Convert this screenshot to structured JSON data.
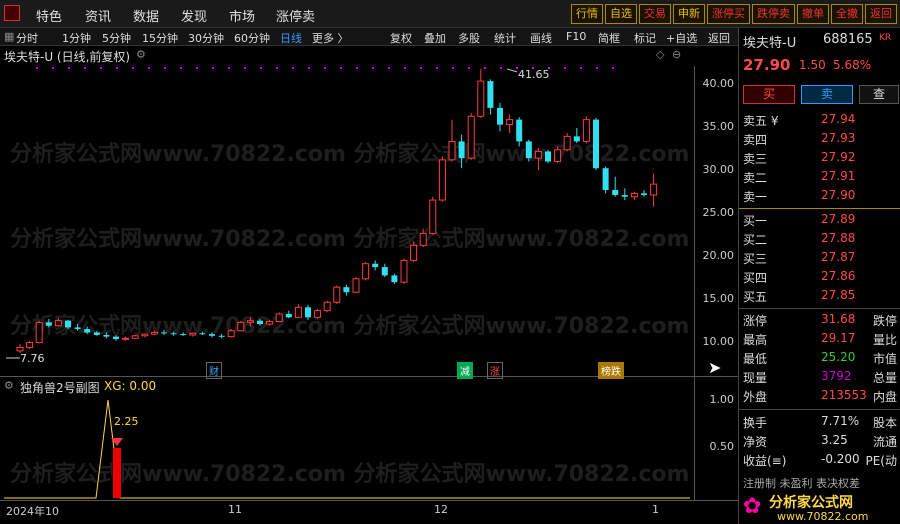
{
  "menu": {
    "items": [
      "特色",
      "资讯",
      "数据",
      "发现",
      "市场",
      "涨停卖"
    ]
  },
  "top_buttons": [
    "行情",
    "自选",
    "交易",
    "申新",
    "涨停买",
    "跌停卖",
    "撤单",
    "全撤",
    "返回"
  ],
  "toolbar": {
    "timeframes": [
      "分时",
      "1分钟",
      "5分钟",
      "15分钟",
      "30分钟",
      "60分钟",
      "日线",
      "更多 〉"
    ],
    "active": "日线",
    "tools": [
      "复权",
      "叠加",
      "多股",
      "统计",
      "画线",
      "F10",
      "简框",
      "标记",
      "+自选",
      "返回"
    ]
  },
  "chart": {
    "title": "埃夫特-U (日线,前复权)",
    "high_label": "41.65",
    "low_label": "7.76",
    "y_ticks": [
      "40.00",
      "35.00",
      "30.00",
      "25.00",
      "20.00",
      "15.00",
      "10.00"
    ],
    "markers": [
      "财",
      "减",
      "涨",
      "榜跌"
    ],
    "sub_title": "独角兽2号副图",
    "sub_value": "XG: 0.00",
    "sub_label": "2.25",
    "sub_y_ticks": [
      "1.00",
      "0.50"
    ],
    "x_ticks": [
      "2024年10",
      "11",
      "12",
      "1"
    ]
  },
  "chart_data": {
    "type": "candlestick",
    "y_range": [
      5,
      42
    ],
    "candles": [
      [
        8.0,
        8.8,
        7.76,
        8.4
      ],
      [
        8.4,
        9.2,
        8.2,
        9.0
      ],
      [
        9.0,
        11.6,
        8.9,
        11.4
      ],
      [
        11.4,
        11.8,
        10.8,
        11.0
      ],
      [
        11.0,
        11.9,
        10.9,
        11.6
      ],
      [
        11.6,
        11.7,
        10.6,
        10.8
      ],
      [
        10.8,
        11.2,
        10.4,
        10.6
      ],
      [
        10.6,
        10.9,
        10.0,
        10.2
      ],
      [
        10.2,
        10.4,
        9.8,
        9.9
      ],
      [
        9.9,
        10.2,
        9.5,
        9.7
      ],
      [
        9.7,
        9.9,
        9.2,
        9.4
      ],
      [
        9.4,
        9.7,
        9.2,
        9.5
      ],
      [
        9.5,
        9.9,
        9.4,
        9.8
      ],
      [
        9.8,
        10.1,
        9.6,
        10.0
      ],
      [
        10.0,
        10.4,
        9.9,
        10.2
      ],
      [
        10.2,
        10.5,
        9.9,
        10.1
      ],
      [
        10.1,
        10.3,
        9.8,
        10.0
      ],
      [
        10.0,
        10.2,
        9.8,
        9.9
      ],
      [
        9.9,
        10.2,
        9.7,
        10.1
      ],
      [
        10.1,
        10.3,
        9.9,
        10.0
      ],
      [
        10.0,
        10.2,
        9.6,
        9.8
      ],
      [
        9.8,
        10.0,
        9.5,
        9.7
      ],
      [
        9.7,
        10.6,
        9.6,
        10.4
      ],
      [
        10.4,
        11.6,
        10.3,
        11.4
      ],
      [
        11.4,
        12.0,
        10.9,
        11.6
      ],
      [
        11.6,
        11.8,
        11.0,
        11.2
      ],
      [
        11.2,
        11.7,
        11.0,
        11.5
      ],
      [
        11.5,
        12.6,
        11.4,
        12.4
      ],
      [
        12.4,
        12.8,
        11.9,
        12.0
      ],
      [
        12.0,
        13.6,
        11.9,
        13.2
      ],
      [
        13.2,
        13.5,
        11.7,
        12.0
      ],
      [
        12.0,
        13.0,
        11.8,
        12.8
      ],
      [
        12.8,
        14.0,
        12.6,
        13.8
      ],
      [
        13.8,
        15.8,
        13.6,
        15.6
      ],
      [
        15.6,
        15.9,
        14.6,
        15.0
      ],
      [
        15.0,
        16.8,
        14.9,
        16.6
      ],
      [
        16.6,
        18.6,
        16.4,
        18.4
      ],
      [
        18.4,
        18.8,
        17.6,
        18.0
      ],
      [
        18.0,
        18.4,
        16.8,
        17.0
      ],
      [
        17.0,
        17.2,
        16.0,
        16.2
      ],
      [
        16.2,
        19.0,
        16.0,
        18.8
      ],
      [
        18.8,
        21.0,
        18.6,
        20.6
      ],
      [
        20.6,
        22.6,
        20.4,
        22.0
      ],
      [
        22.0,
        26.4,
        21.8,
        26.0
      ],
      [
        26.0,
        31.2,
        25.8,
        30.8
      ],
      [
        30.8,
        35.6,
        30.6,
        33.0
      ],
      [
        33.0,
        33.8,
        29.8,
        31.0
      ],
      [
        31.0,
        36.4,
        30.8,
        36.0
      ],
      [
        36.0,
        41.65,
        35.8,
        40.2
      ],
      [
        40.2,
        40.4,
        36.2,
        37.0
      ],
      [
        37.0,
        37.6,
        34.2,
        35.0
      ],
      [
        35.0,
        36.2,
        34.0,
        35.6
      ],
      [
        35.6,
        35.9,
        32.4,
        33.0
      ],
      [
        33.0,
        33.2,
        30.6,
        31.0
      ],
      [
        31.0,
        32.2,
        29.6,
        31.8
      ],
      [
        31.8,
        32.0,
        30.4,
        30.6
      ],
      [
        30.6,
        32.4,
        30.4,
        32.0
      ],
      [
        32.0,
        34.0,
        31.8,
        33.6
      ],
      [
        33.6,
        34.6,
        32.8,
        33.0
      ],
      [
        33.0,
        36.0,
        32.8,
        35.6
      ],
      [
        35.6,
        35.8,
        29.6,
        29.8
      ],
      [
        29.8,
        30.0,
        26.8,
        27.2
      ],
      [
        27.2,
        28.8,
        26.4,
        26.6
      ],
      [
        26.6,
        27.4,
        26.0,
        26.4
      ],
      [
        26.4,
        27.0,
        26.0,
        26.8
      ],
      [
        26.8,
        27.2,
        26.4,
        26.6
      ],
      [
        26.6,
        29.17,
        25.2,
        27.9
      ]
    ]
  },
  "right_panel": {
    "name": "埃夫特-U",
    "code": "688165",
    "price": "27.90",
    "change": "1.50",
    "pct": "5.68%",
    "btn_buy": "买",
    "btn_sell": "卖",
    "btn_check": "查",
    "asks": [
      [
        "卖五 ¥",
        "27.94"
      ],
      [
        "卖四",
        "27.93"
      ],
      [
        "卖三",
        "27.92"
      ],
      [
        "卖二",
        "27.91"
      ],
      [
        "卖一",
        "27.90"
      ]
    ],
    "bids": [
      [
        "买一",
        "27.89"
      ],
      [
        "买二",
        "27.88"
      ],
      [
        "买三",
        "27.87"
      ],
      [
        "买四",
        "27.86"
      ],
      [
        "买五",
        "27.85"
      ]
    ],
    "stats": [
      [
        "涨停",
        "31.68",
        "跌停"
      ],
      [
        "最高",
        "29.17",
        "量比"
      ],
      [
        "最低",
        "25.20",
        "市值"
      ],
      [
        "现量",
        "3792",
        "总量"
      ],
      [
        "外盘",
        "213553",
        "内盘"
      ],
      [
        "换手",
        "7.71%",
        "股本"
      ],
      [
        "净资",
        "3.25",
        "流通"
      ],
      [
        "收益(≡)",
        "-0.200",
        "PE(动"
      ]
    ],
    "bottom_text": "注册制 未盈利 表决权差",
    "brand": "分析家公式网",
    "brand_url": "www.70822.com"
  },
  "colors": {
    "up": "#ff3b3b",
    "down": "#30e0f0",
    "accent": "#3399ff",
    "yellow": "#ffd84a"
  }
}
